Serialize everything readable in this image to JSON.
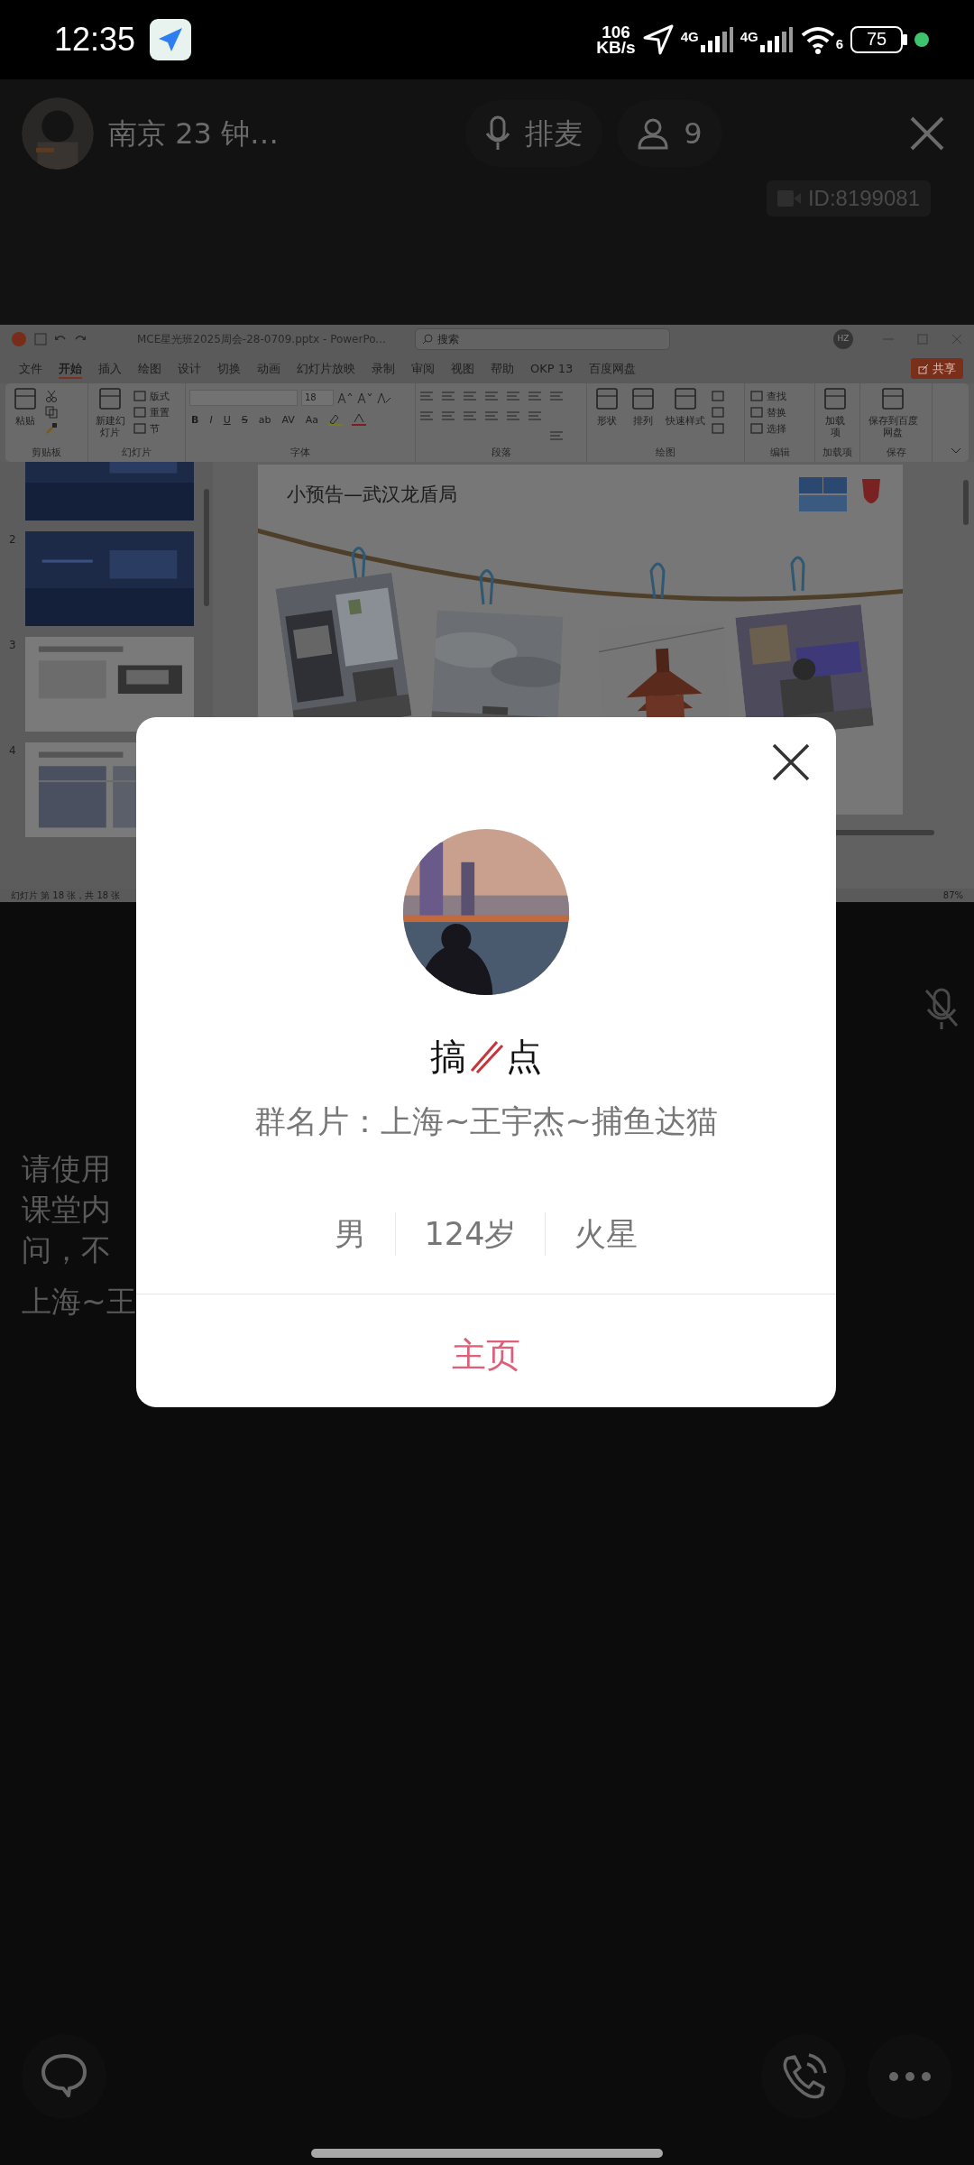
{
  "status_bar": {
    "time": "12:35",
    "net_speed_value": "106",
    "net_speed_unit": "KB/s",
    "sim_1": "4G",
    "sim_2": "4G",
    "wifi_label": "6",
    "battery": "75"
  },
  "room_bar": {
    "title": "南京 23 钟…",
    "queue_label": "排麦",
    "member_count": "9",
    "room_id": "ID:8199081"
  },
  "screen_share": {
    "window_title": "MCE星光班2025周会-28-0709.pptx - PowerPo...",
    "search_placeholder": "搜索",
    "user_initials": "HZ",
    "ribbon_tabs": [
      {
        "label": "文件",
        "selected": false
      },
      {
        "label": "开始",
        "selected": true
      },
      {
        "label": "插入",
        "selected": false
      },
      {
        "label": "绘图",
        "selected": false
      },
      {
        "label": "设计",
        "selected": false
      },
      {
        "label": "切换",
        "selected": false
      },
      {
        "label": "动画",
        "selected": false
      },
      {
        "label": "幻灯片放映",
        "selected": false
      },
      {
        "label": "录制",
        "selected": false
      },
      {
        "label": "审阅",
        "selected": false
      },
      {
        "label": "视图",
        "selected": false
      },
      {
        "label": "帮助",
        "selected": false
      },
      {
        "label": "OKP 13",
        "selected": false
      },
      {
        "label": "百度网盘",
        "selected": false
      }
    ],
    "share_button": "共享",
    "ribbon_groups": [
      {
        "kind": "clipboard",
        "label": "剪贴板",
        "paste": "粘贴"
      },
      {
        "kind": "slides",
        "label": "幻灯片",
        "new_slide": "新建幻灯片",
        "layout": "版式",
        "reset": "重置",
        "section": "节"
      },
      {
        "kind": "font",
        "label": "字体",
        "font_size": "18",
        "format_buttons": [
          "B",
          "I",
          "U",
          "S",
          "ab",
          "AV",
          "Aa"
        ]
      },
      {
        "kind": "paragraph",
        "label": "段落"
      },
      {
        "kind": "drawing",
        "label": "绘图",
        "shapes": "形状",
        "arrange": "排列",
        "quick_styles": "快速样式"
      },
      {
        "kind": "editing",
        "label": "编辑",
        "find": "查找",
        "replace": "替换",
        "select": "选择"
      },
      {
        "kind": "addins",
        "label": "加载项",
        "addins_button": "加载项"
      },
      {
        "kind": "save",
        "label": "保存",
        "save_button": "保存到百度网盘"
      }
    ],
    "thumbnails": [
      {
        "kind": "picture"
      },
      {
        "kind": "picture",
        "number": "2"
      },
      {
        "kind": "picture",
        "number": "3"
      },
      {
        "kind": "picture",
        "number": "4"
      }
    ],
    "slide": {
      "title": "小预告—武汉龙盾局",
      "photos": [
        {
          "kind": "picture"
        },
        {
          "kind": "picture"
        },
        {
          "kind": "picture"
        },
        {
          "kind": "picture"
        }
      ]
    },
    "status_text": "幻灯片 第 18 张，共 18 张",
    "zoom": "87%"
  },
  "self_mic_muted": true,
  "notice_lines": [
    "请使用",
    "课堂内",
    "问，不"
  ],
  "sender": "上海~王",
  "profile_card": {
    "name_before": "搞",
    "name_after": "点",
    "group_card": "群名片：上海~王宇杰~捕鱼达猫",
    "details": [
      "男",
      "124岁",
      "火星"
    ],
    "home_link": "主页"
  }
}
